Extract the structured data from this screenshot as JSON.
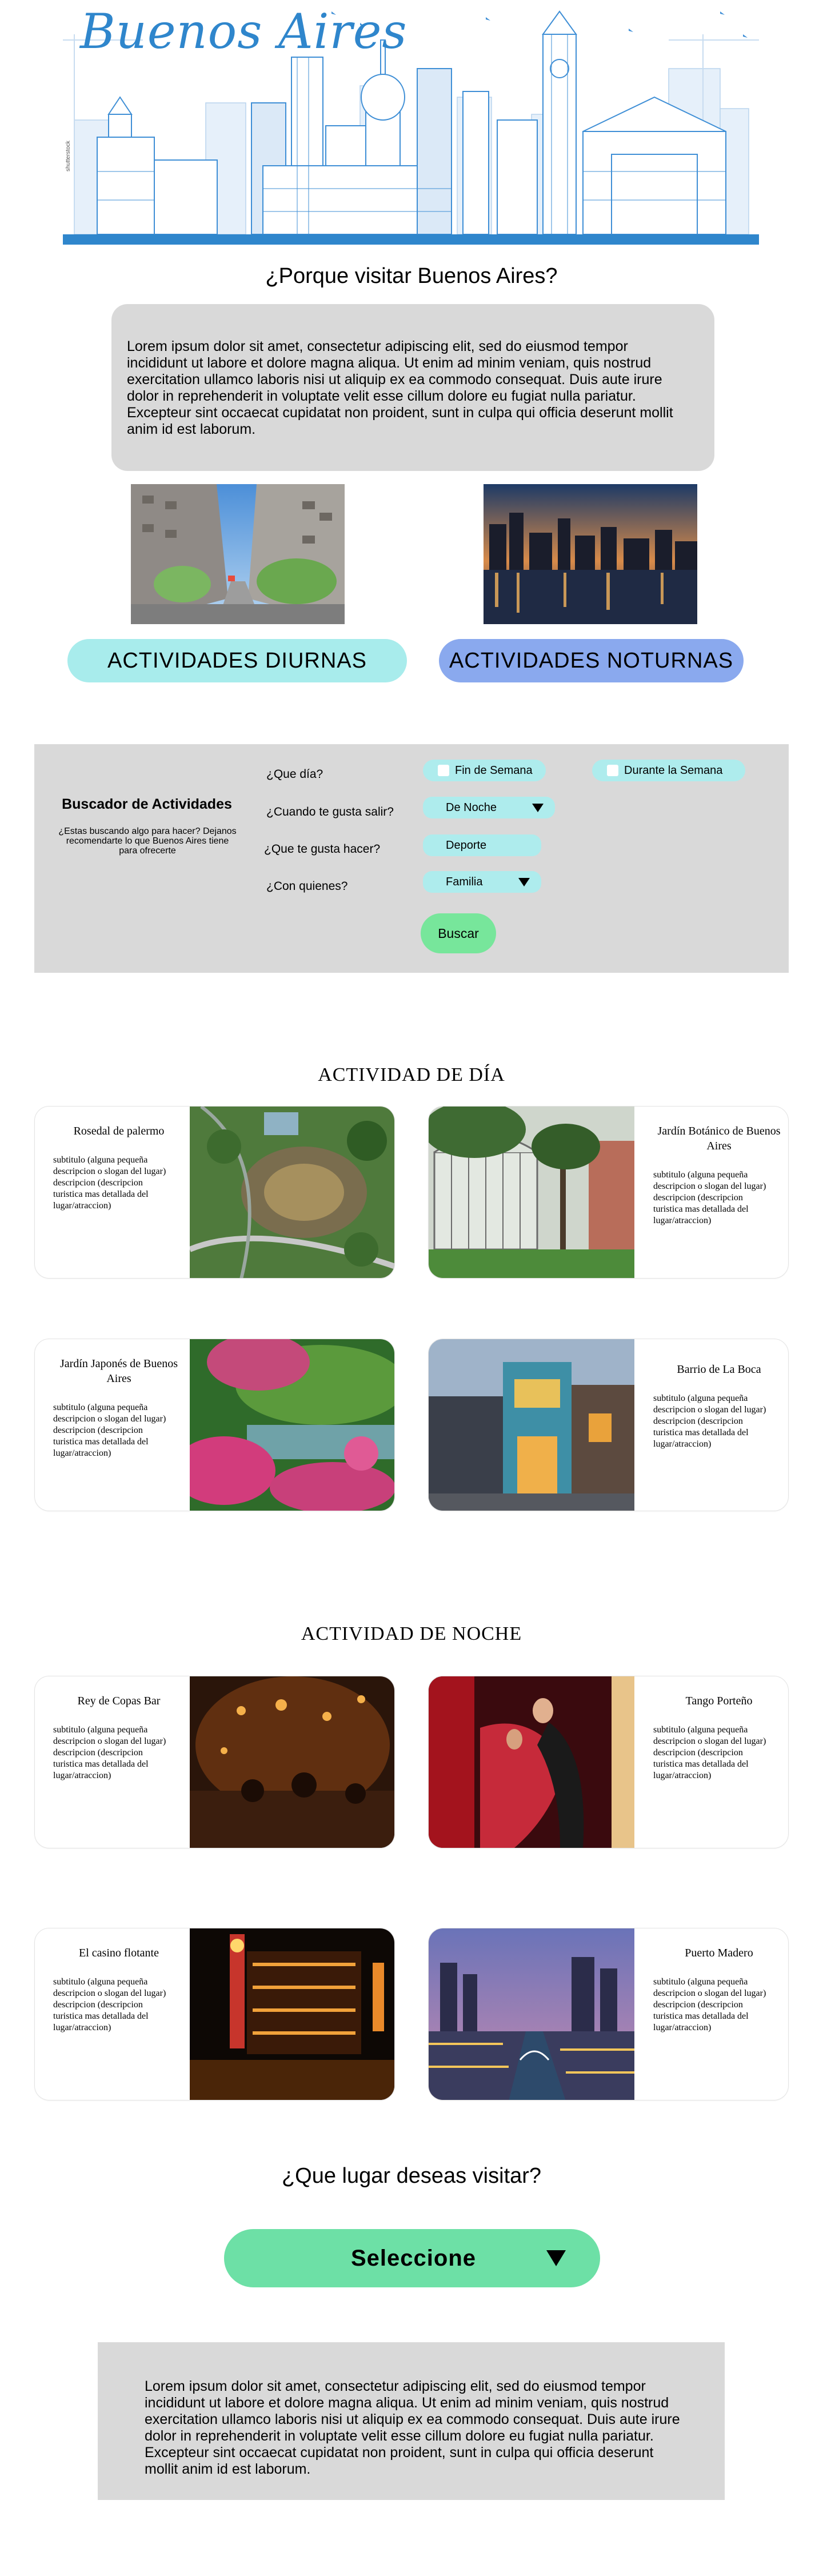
{
  "banner": {
    "title": "Buenos Aires",
    "side_text": "shutterstock"
  },
  "why": {
    "heading": "¿Porque visitar Buenos Aires?",
    "body": "Lorem ipsum dolor sit amet, consectetur adipiscing elit, sed do eiusmod tempor incididunt ut labore et dolore magna aliqua. Ut enim ad minim veniam, quis nostrud exercitation ullamco laboris nisi ut aliquip ex ea commodo consequat. Duis aute irure dolor in reprehenderit in voluptate velit esse cillum dolore eu fugiat nulla pariatur. Excepteur sint occaecat cupidatat non proident, sunt in culpa qui officia deserunt mollit anim id est laborum."
  },
  "buttons": {
    "day": "ACTIVIDADES DIURNAS",
    "night": "ACTIVIDADES NOTURNAS"
  },
  "finder": {
    "title": "Buscador de Actividades",
    "description": "¿Estas buscando algo para hacer? Dejanos recomendarte lo que Buenos Aires tiene para ofrecerte",
    "q_day": "¿Que día?",
    "q_when": "¿Cuando te gusta salir?",
    "q_what": "¿Que te gusta hacer?",
    "q_who": "¿Con quienes?",
    "opt_weekend": "Fin de Semana",
    "opt_week": "Durante la Semana",
    "sel_when": "De Noche",
    "sel_what": "Deporte",
    "sel_who": "Familia",
    "search_button": "Buscar"
  },
  "day_section": {
    "heading": "ACTIVIDAD DE DÍA",
    "cards": [
      {
        "title": "Rosedal de palermo",
        "desc": "subtitulo (alguna pequeña descripcion o slogan del lugar)\ndescripcion (descripcion turistica mas detallada del lugar/atraccion)"
      },
      {
        "title": "Jardín Botánico de Buenos Aires",
        "desc": "subtitulo (alguna pequeña descripcion o slogan del lugar)\ndescripcion (descripcion turistica mas detallada del lugar/atraccion)"
      },
      {
        "title": "Jardín Japonés de Buenos Aires",
        "desc": "subtitulo (alguna pequeña descripcion o slogan del lugar)\ndescripcion (descripcion turistica mas detallada del lugar/atraccion)"
      },
      {
        "title": "Barrio de La Boca",
        "desc": "subtitulo (alguna pequeña descripcion o slogan del lugar)\ndescripcion (descripcion turistica mas detallada del lugar/atraccion)"
      }
    ]
  },
  "night_section": {
    "heading": "ACTIVIDAD DE NOCHE",
    "cards": [
      {
        "title": "Rey de Copas Bar",
        "desc": "subtitulo (alguna pequeña descripcion o slogan del lugar)\ndescripcion (descripcion turistica mas detallada del lugar/atraccion)"
      },
      {
        "title": "Tango Porteño",
        "desc": "subtitulo (alguna pequeña descripcion o slogan del lugar)\ndescripcion (descripcion turistica mas detallada del lugar/atraccion)"
      },
      {
        "title": "El casino flotante",
        "desc": "subtitulo (alguna pequeña descripcion o slogan del lugar)\ndescripcion (descripcion turistica mas detallada del lugar/atraccion)"
      },
      {
        "title": "Puerto Madero",
        "desc": "subtitulo (alguna pequeña descripcion o slogan del lugar)\ndescripcion (descripcion turistica mas detallada del lugar/atraccion)"
      }
    ]
  },
  "visit": {
    "heading": "¿Que  lugar deseas visitar?",
    "select_label": "Seleccione",
    "footer_text": "Lorem ipsum dolor sit amet, consectetur adipiscing elit, sed do eiusmod tempor incididunt ut labore et dolore magna aliqua. Ut enim ad minim veniam, quis nostrud exercitation ullamco laboris nisi ut aliquip ex ea commodo consequat. Duis aute irure dolor in reprehenderit in voluptate velit esse cillum dolore eu fugiat nulla pariatur. Excepteur sint occaecat cupidatat non proident, sunt in culpa qui officia deserunt mollit anim id est laborum."
  },
  "colors": {
    "banner_blue": "#2f86cc",
    "gray_box": "#d9d9d9",
    "day_button": "#a8ecec",
    "night_button": "#8aa9ee",
    "chip": "#aeeced",
    "search_button": "#77e69b",
    "select_green": "#6de0a6"
  }
}
